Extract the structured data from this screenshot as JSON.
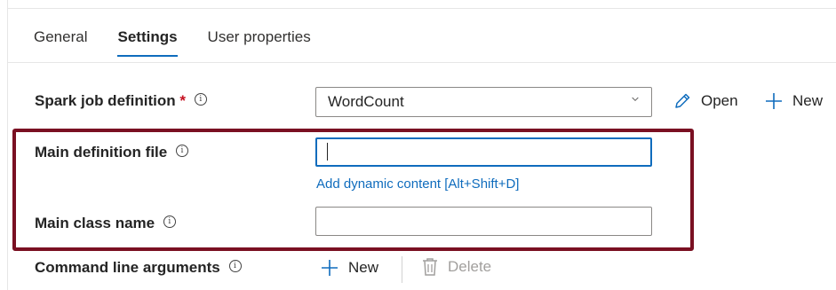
{
  "tabs": [
    {
      "label": "General"
    },
    {
      "label": "Settings"
    },
    {
      "label": "User properties"
    }
  ],
  "spark_job": {
    "label": "Spark job definition",
    "required_mark": "*",
    "selected_value": "WordCount",
    "open_label": "Open",
    "new_label": "New"
  },
  "main_definition_file": {
    "label": "Main definition file",
    "value": "",
    "dynamic_content_link": "Add dynamic content [Alt+Shift+D]"
  },
  "main_class_name": {
    "label": "Main class name",
    "value": ""
  },
  "command_line_arguments": {
    "label": "Command line arguments",
    "new_label": "New",
    "delete_label": "Delete"
  },
  "colors": {
    "accent": "#0f6cbd",
    "highlight_border": "#7a1022",
    "required": "#c50f1f"
  },
  "icons": {
    "info": "info-icon",
    "chevron": "chevron-down-icon",
    "edit": "pencil-icon",
    "add": "plus-icon",
    "delete": "trash-icon"
  }
}
